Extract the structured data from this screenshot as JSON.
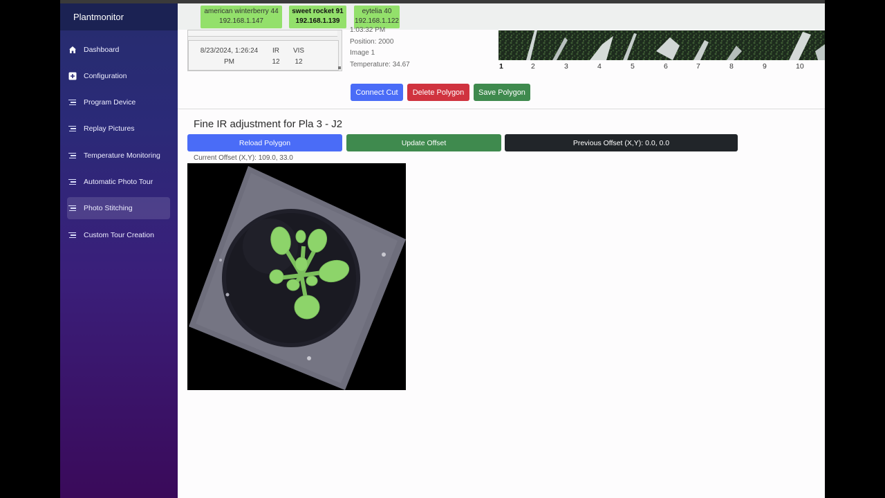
{
  "app": {
    "title": "Plantmonitor"
  },
  "sidebar": {
    "items": [
      {
        "label": "Dashboard",
        "icon": "home-icon"
      },
      {
        "label": "Configuration",
        "icon": "plus-square-icon"
      },
      {
        "label": "Program Device",
        "icon": "list-icon"
      },
      {
        "label": "Replay Pictures",
        "icon": "list-icon"
      },
      {
        "label": "Temperature Monitoring",
        "icon": "list-icon"
      },
      {
        "label": "Automatic Photo Tour",
        "icon": "list-icon"
      },
      {
        "label": "Photo Stitching",
        "icon": "list-icon",
        "active": true
      },
      {
        "label": "Custom Tour Creation",
        "icon": "list-icon"
      }
    ]
  },
  "devices": [
    {
      "name": "american winterberry 44",
      "ip": "192.168.1.147"
    },
    {
      "name": "sweet rocket 91",
      "ip": "192.168.1.139",
      "selected": true
    },
    {
      "name": "eytelia 40",
      "ip": "192.168.1.122"
    }
  ],
  "image_table": {
    "row": {
      "date": "8/23/2024, 1:26:24",
      "time": "PM",
      "ir_label": "IR",
      "ir_value": "12",
      "vis_label": "VIS",
      "vis_value": "12"
    }
  },
  "image_info": {
    "time": "1:03:32 PM",
    "position": "Position: 2000",
    "image": "Image 1",
    "temperature": "Temperature: 34.67"
  },
  "strip_numbers": [
    "1",
    "2",
    "3",
    "4",
    "5",
    "6",
    "7",
    "8",
    "9",
    "10"
  ],
  "actions": {
    "connect_cut": "Connect Cut",
    "delete_polygon": "Delete Polygon",
    "save_polygon": "Save Polygon"
  },
  "fine_ir": {
    "title": "Fine IR adjustment for Pla 3 - J2",
    "reload_polygon": "Reload Polygon",
    "update_offset": "Update Offset",
    "previous_offset": "Previous Offset (X,Y): 0.0, 0.0",
    "current_offset": "Current Offset (X,Y): 109.0, 33.0"
  },
  "colors": {
    "primary": "#4a6cf7",
    "danger": "#d0333f",
    "success": "#3f8a4e",
    "dark": "#212529",
    "device_green": "#93e06b",
    "leaf_green": "#8dd46a"
  }
}
